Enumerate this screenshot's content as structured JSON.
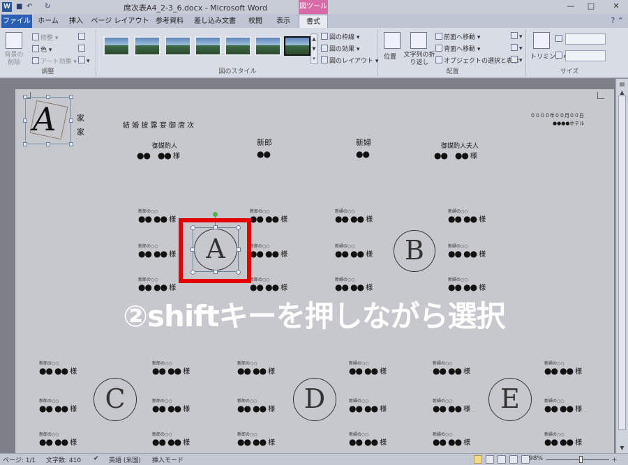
{
  "titlebar": {
    "title": "席次表A4_2-3_6.docx - Microsoft Word",
    "context_tab": "図ツール",
    "app_icon": "W",
    "undo": "↶",
    "redo": "↻",
    "minimize": "—",
    "maximize": "□",
    "close": "✕"
  },
  "tabs": {
    "file": "ファイル",
    "items": [
      "ホーム",
      "挿入",
      "ページ レイアウト",
      "参考資料",
      "差し込み文書",
      "校閲",
      "表示"
    ],
    "active": "書式"
  },
  "ribbon": {
    "adjust": {
      "remove_bg": "背景の削除",
      "corrections": "修整",
      "color": "色",
      "artistic": "アート効果",
      "label": "調整"
    },
    "styles": {
      "label": "図のスタイル",
      "border": "図の枠線",
      "effects": "図の効果",
      "layout": "図のレイアウト"
    },
    "arrange": {
      "position": "位置",
      "wrap": "文字列の折り返し",
      "bring_forward": "前面へ移動",
      "send_backward": "背面へ移動",
      "selection_pane": "オブジェクトの選択と表示",
      "label": "配置"
    },
    "size": {
      "crop": "トリミング",
      "label": "サイズ"
    }
  },
  "document": {
    "header_title": "結 婚 披 露 宴 御 席 次",
    "date": "００００年００月００日",
    "venue": "●●●●ホテル",
    "logo_letter": "A",
    "family_1": "家",
    "family_2": "家",
    "head_table": [
      {
        "role": "御媒酌人",
        "name": "●●　●●",
        "sama": "様"
      },
      {
        "role": "新郎",
        "name": "●●",
        "sama": ""
      },
      {
        "role": "新婦",
        "name": "●●",
        "sama": ""
      },
      {
        "role": "御媒酌人夫人",
        "name": "●●　●●",
        "sama": "様"
      }
    ],
    "guest_label": "新郎の○○",
    "guest_label_bride": "新婦の○○",
    "guest_name": "●● ●●",
    "sama": "様",
    "para_mark": "↵",
    "tables": [
      "A",
      "B",
      "C",
      "D",
      "E"
    ]
  },
  "overlay": {
    "caption": "②shiftキーを押しながら選択"
  },
  "statusbar": {
    "page": "ページ: 1/1",
    "words": "文字数: 410",
    "language": "英語 (米国)",
    "mode": "挿入モード",
    "zoom": "98%",
    "zoom_out": "－",
    "zoom_in": "＋"
  }
}
